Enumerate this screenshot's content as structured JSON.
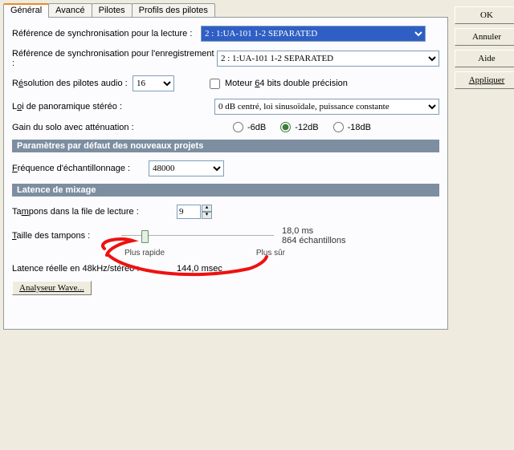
{
  "buttons": {
    "ok": "OK",
    "cancel": "Annuler",
    "help": "Aide",
    "apply": "Appliquer",
    "wave": "Analyseur Wave..."
  },
  "tabs": {
    "general": "Général",
    "advanced": "Avancé",
    "drivers": "Pilotes",
    "profiles": "Profils des pilotes"
  },
  "labels": {
    "playSync": "Référence de synchronisation pour la lecture :",
    "recSync": "Référence de synchronisation pour l'enregistrement :",
    "res_pre": "R",
    "res_u": "é",
    "res_post": "solution des pilotes audio :",
    "engine64_pre": "Moteur ",
    "engine64_u": "6",
    "engine64_post": "4 bits double précision",
    "pan_pre": "L",
    "pan_u": "o",
    "pan_post": "i de panoramique stéréo :",
    "soloGain": "Gain du solo avec atténuation :",
    "sectDefaults": "Paramètres par défaut des nouveaux projets",
    "sampleRate_pre": "",
    "sampleRate_u": "F",
    "sampleRate_post": "réquence d'échantillonnage :",
    "sectLatency": "Latence de mixage",
    "buffers_pre": "Ta",
    "buffers_u": "m",
    "buffers_post": "pons dans la file de lecture :",
    "bufSize_pre": "",
    "bufSize_u": "T",
    "bufSize_post": "aille des tampons :",
    "faster": "Plus rapide",
    "safer": "Plus sûr",
    "latMs": "18,0 ms",
    "latSamples": "864 échantillons",
    "realLat": "Latence réelle en 48kHz/stéréo :",
    "realLatVal": "144,0 msec"
  },
  "values": {
    "playSync": "2 : 1:UA-101 1-2 SEPARATED",
    "recSync": "2 : 1:UA-101 1-2 SEPARATED",
    "bits": "16",
    "panLaw": "0 dB centré, loi sinusoïdale, puissance constante",
    "sampleRate": "48000",
    "buffers": "9"
  },
  "radios": {
    "r6": "-6dB",
    "r12": "-12dB",
    "r18": "-18dB"
  }
}
